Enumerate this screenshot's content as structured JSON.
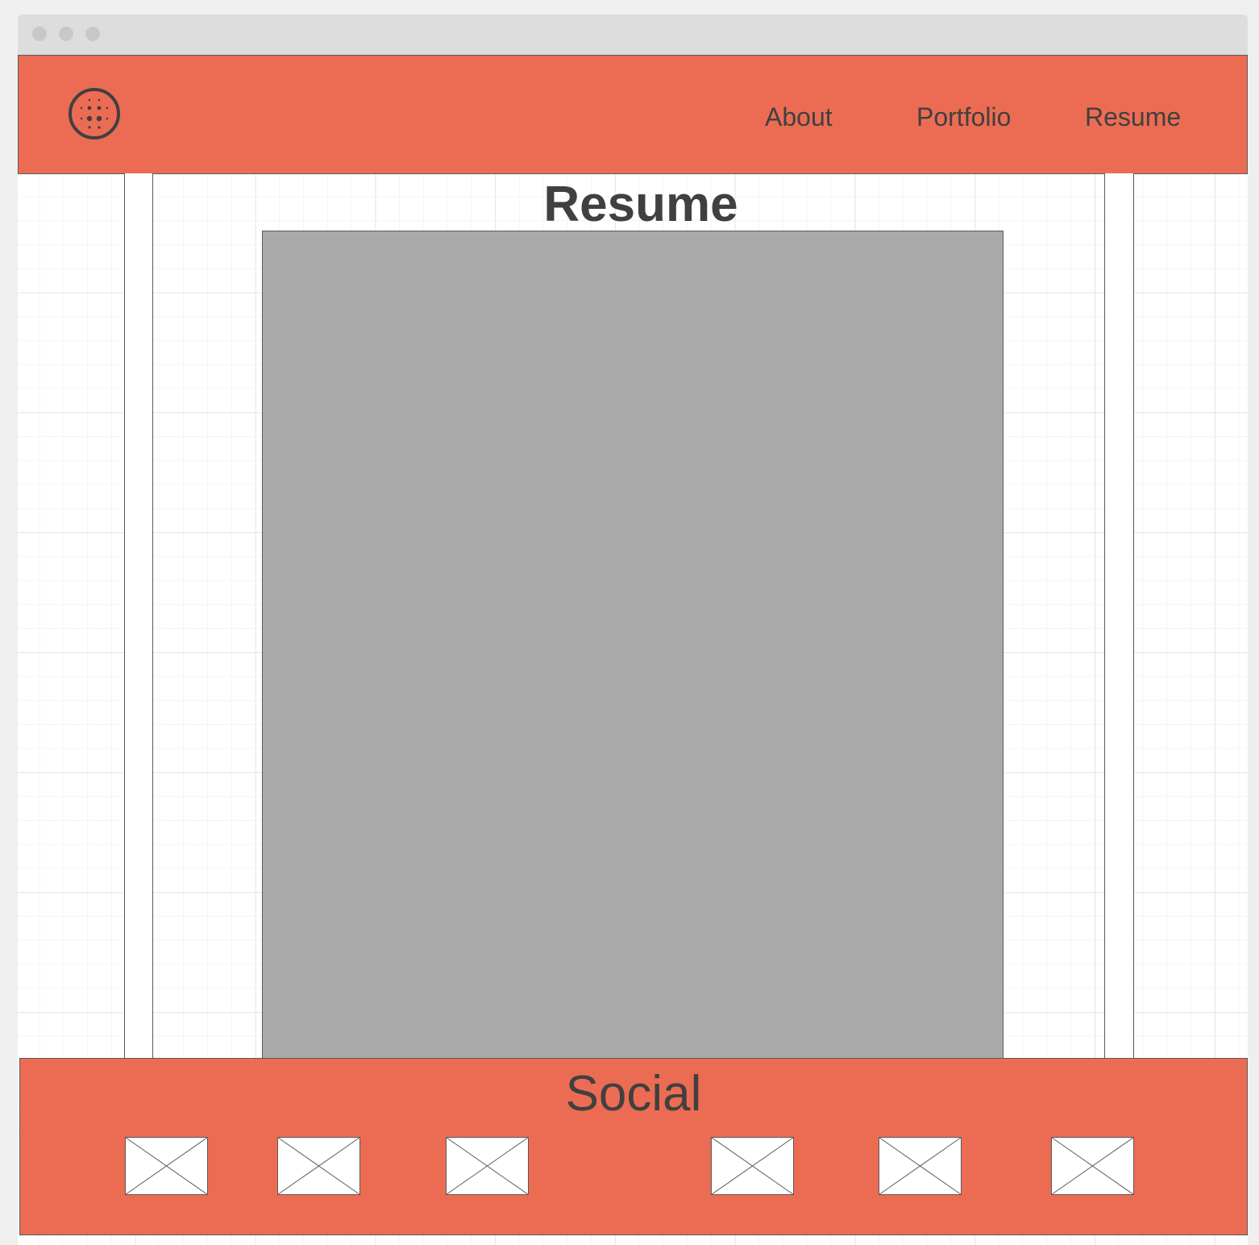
{
  "window": {
    "controls": [
      "close-dot",
      "minimize-dot",
      "zoom-dot"
    ]
  },
  "header": {
    "logo_icon": "dotted-globe-icon",
    "nav": [
      {
        "label": "About"
      },
      {
        "label": "Portfolio"
      },
      {
        "label": "Resume"
      }
    ]
  },
  "main": {
    "title": "Resume",
    "document_placeholder": "image-placeholder"
  },
  "footer": {
    "title": "Social",
    "icons": [
      "social-image-placeholder-icon",
      "social-image-placeholder-icon",
      "social-image-placeholder-icon",
      "social-image-placeholder-icon",
      "social-image-placeholder-icon",
      "social-image-placeholder-icon"
    ]
  },
  "colors": {
    "accent": "#ec6c53",
    "text": "#404040",
    "placeholder": "#aaaaaa",
    "outline": "#5a5a5a"
  }
}
